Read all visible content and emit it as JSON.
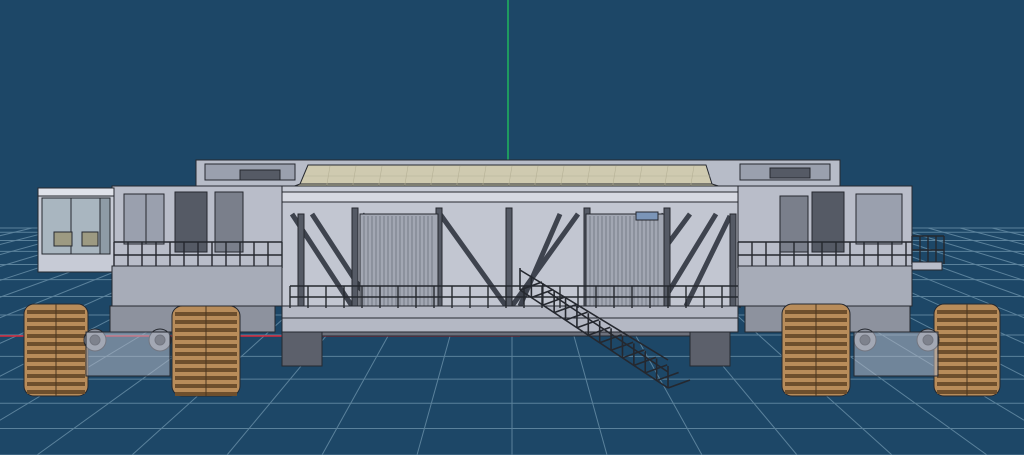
{
  "viewport": {
    "mode": "3d-modeling-viewport",
    "view": "front-orthographic",
    "background_color": "#1d4767",
    "grid_color": "#6f95ad",
    "axis_colors": {
      "vertical": "#1fd15a",
      "horizontal": "#d6283a"
    }
  },
  "model": {
    "subject": "crawler-transporter",
    "render_style": "wireframe-shaded",
    "body_color": "#c7cbd6",
    "shadow_color": "#8c91a0",
    "outline_color": "#25282f",
    "deck_color": "#d8d3b6",
    "tread_color": "#b88c5a",
    "tread_dark_color": "#6e4f2d",
    "glass_color": "#a9b6c0",
    "icons": [
      "operator-cab-icon",
      "crawler-track-icon",
      "stair-icon",
      "truss-icon",
      "railing-icon"
    ]
  }
}
